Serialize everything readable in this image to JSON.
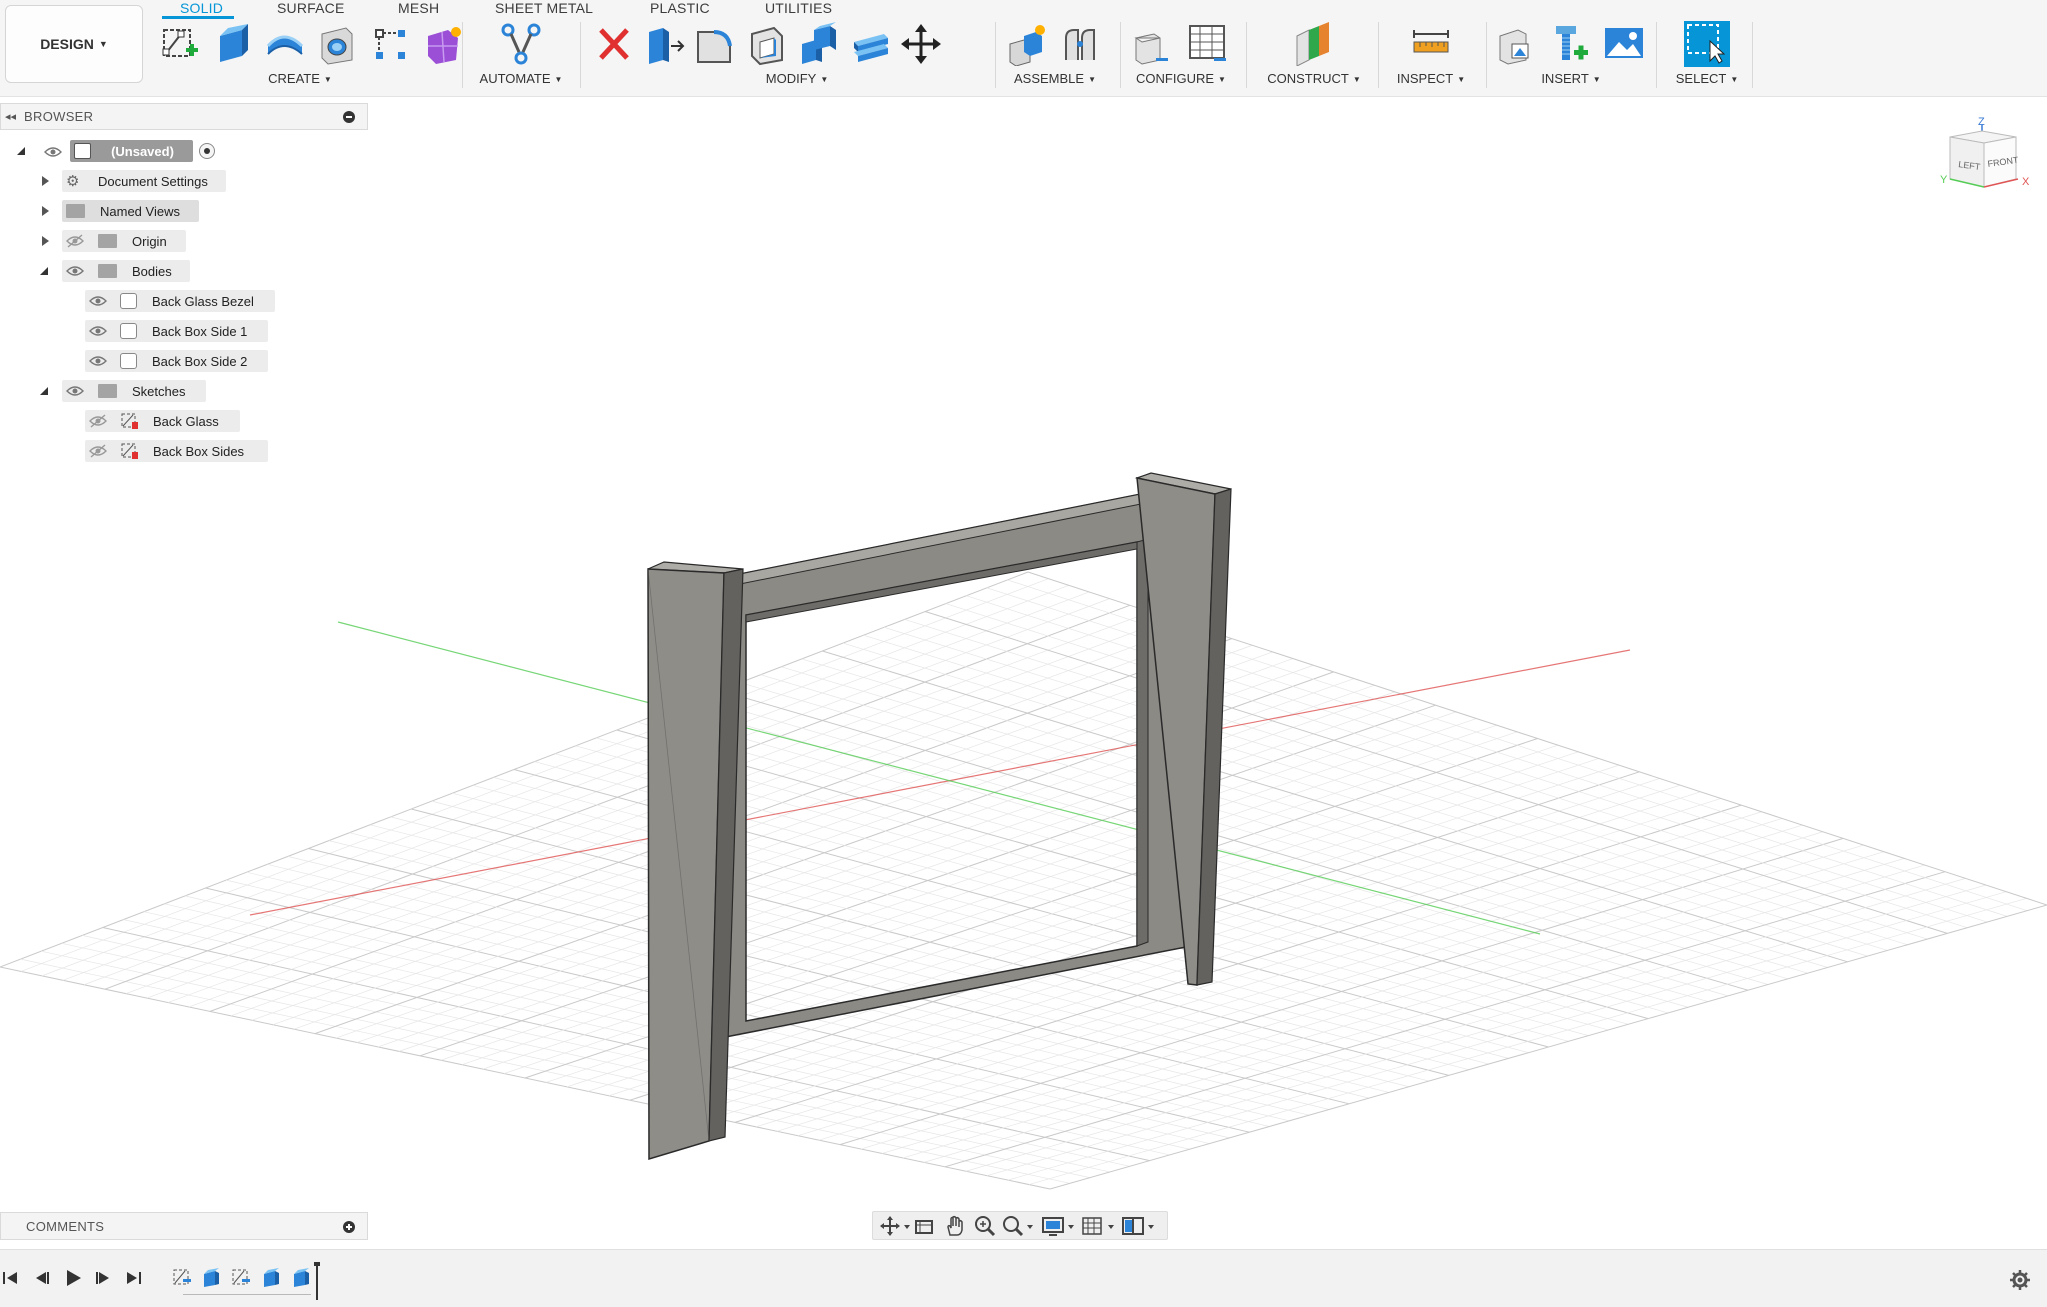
{
  "workspace": {
    "label": "DESIGN"
  },
  "tabs": [
    {
      "label": "SOLID",
      "active": true
    },
    {
      "label": "SURFACE"
    },
    {
      "label": "MESH"
    },
    {
      "label": "SHEET METAL"
    },
    {
      "label": "PLASTIC"
    },
    {
      "label": "UTILITIES"
    }
  ],
  "groups": {
    "create": "CREATE",
    "automate": "AUTOMATE",
    "modify": "MODIFY",
    "assemble": "ASSEMBLE",
    "configure": "CONFIGURE",
    "construct": "CONSTRUCT",
    "inspect": "INSPECT",
    "insert": "INSERT",
    "select": "SELECT"
  },
  "browser": {
    "title": "BROWSER",
    "root": "(Unsaved)",
    "items": [
      {
        "label": "Document Settings"
      },
      {
        "label": "Named Views"
      },
      {
        "label": "Origin"
      },
      {
        "label": "Bodies"
      },
      {
        "label": "Back Glass Bezel"
      },
      {
        "label": "Back Box Side 1"
      },
      {
        "label": "Back Box Side 2"
      },
      {
        "label": "Sketches"
      },
      {
        "label": "Back Glass"
      },
      {
        "label": "Back Box Sides"
      }
    ]
  },
  "comments": {
    "title": "COMMENTS"
  },
  "viewcube": {
    "top": "Z",
    "left": "LEFT",
    "front": "FRONT",
    "axis_x": "X",
    "axis_y": "Y"
  },
  "colors": {
    "accent": "#0696d7",
    "delete_red": "#e03030",
    "body_gray": "#8c8a85",
    "x_axis": "#e05555",
    "y_axis": "#55cc55",
    "grid": "#dadada"
  },
  "icons": {
    "create_sketch": "create-sketch-icon",
    "extrude": "extrude-icon",
    "revolve": "revolve-icon",
    "hole": "hole-icon",
    "pattern": "pattern-icon",
    "form": "form-icon",
    "automate": "automate-icon",
    "delete": "delete-icon",
    "press_pull": "press-pull-icon",
    "fillet": "fillet-icon",
    "shell": "shell-icon",
    "combine": "combine-icon",
    "scale": "scale-icon",
    "move": "move-icon"
  }
}
